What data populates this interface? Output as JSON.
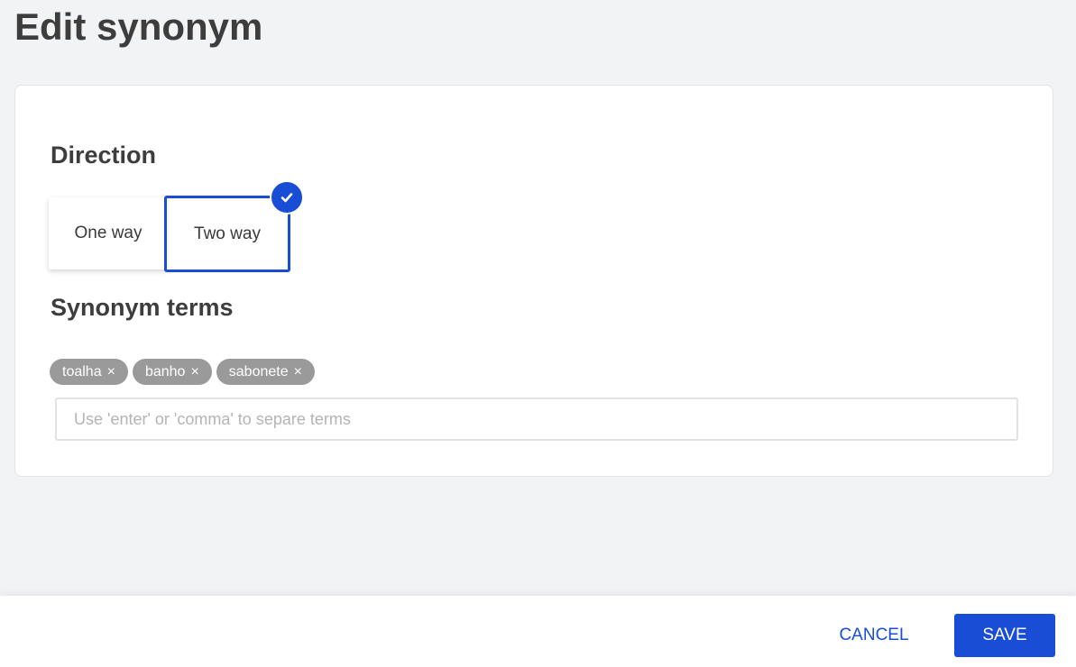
{
  "page": {
    "title": "Edit synonym"
  },
  "direction": {
    "title": "Direction",
    "options": [
      {
        "label": "One way",
        "selected": false
      },
      {
        "label": "Two way",
        "selected": true
      }
    ],
    "selected_icon": "check-icon"
  },
  "terms": {
    "title": "Synonym terms",
    "chips": [
      {
        "label": "toalha",
        "remove": "×"
      },
      {
        "label": "banho",
        "remove": "×"
      },
      {
        "label": "sabonete",
        "remove": "×"
      }
    ],
    "input_value": "",
    "input_placeholder": "Use 'enter' or 'comma' to separe terms"
  },
  "footer": {
    "cancel_label": "CANCEL",
    "save_label": "SAVE"
  },
  "colors": {
    "accent": "#1a4dd6",
    "chip_bg": "#9a9a9a",
    "page_bg": "#f2f3f5"
  }
}
